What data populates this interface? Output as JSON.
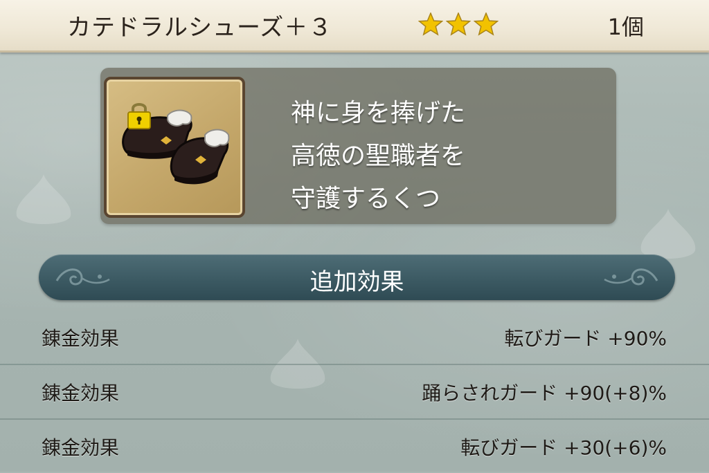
{
  "header": {
    "item_name": "カテドラルシューズ＋３",
    "star_count": 3,
    "star_color": "#f2c200",
    "quantity": "1個"
  },
  "item": {
    "icon": "boots-icon",
    "lock_icon": "padlock-icon",
    "description_lines": [
      "神に身を捧げた",
      "高徳の聖職者を",
      "守護するくつ"
    ]
  },
  "section": {
    "title": "追加効果"
  },
  "effects": [
    {
      "label": "錬金効果",
      "value": "転びガード  +90%"
    },
    {
      "label": "錬金効果",
      "value": "踊らされガード  +90(+8)%"
    },
    {
      "label": "錬金効果",
      "value": "転びガード  +30(+6)%"
    }
  ],
  "colors": {
    "header_bg": "#efe8d6",
    "section_bar": "#3c5a63",
    "background": "#a9b7b3"
  }
}
